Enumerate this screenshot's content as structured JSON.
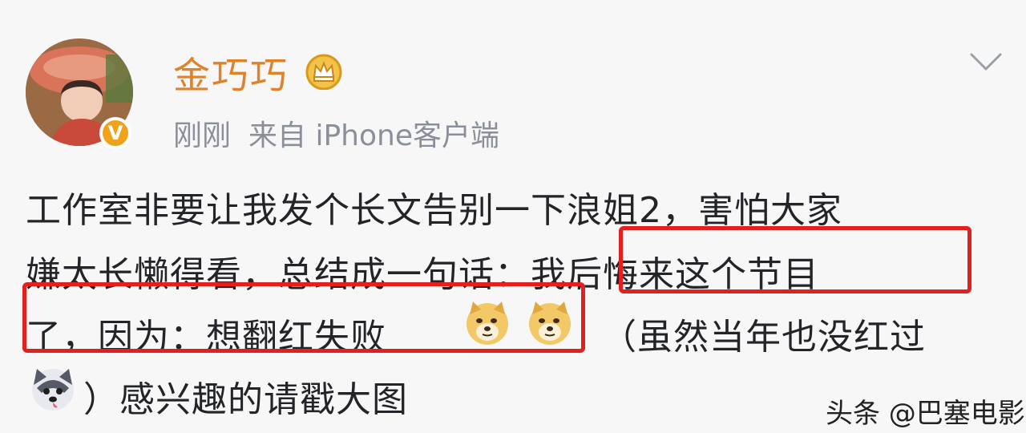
{
  "post": {
    "username": "金巧巧",
    "time": "刚刚",
    "source": "来自 iPhone客户端",
    "verified_icon": "verified-v-badge",
    "crown_icon": "vip-crown",
    "expand_icon": "chevron-down",
    "lines": [
      "工作室非要让我发个长文告别一下浪姐2，害怕大家",
      "嫌太长懒得看，总结成一句话：我后悔来这个节目",
      "了，因为：想翻红失败",
      "（虽然当年也没红过",
      "）感兴趣的请戳大图"
    ],
    "highlight_color": "#e32020",
    "accent_color": "#e0822a"
  },
  "watermark": "头条 @巴塞电影"
}
